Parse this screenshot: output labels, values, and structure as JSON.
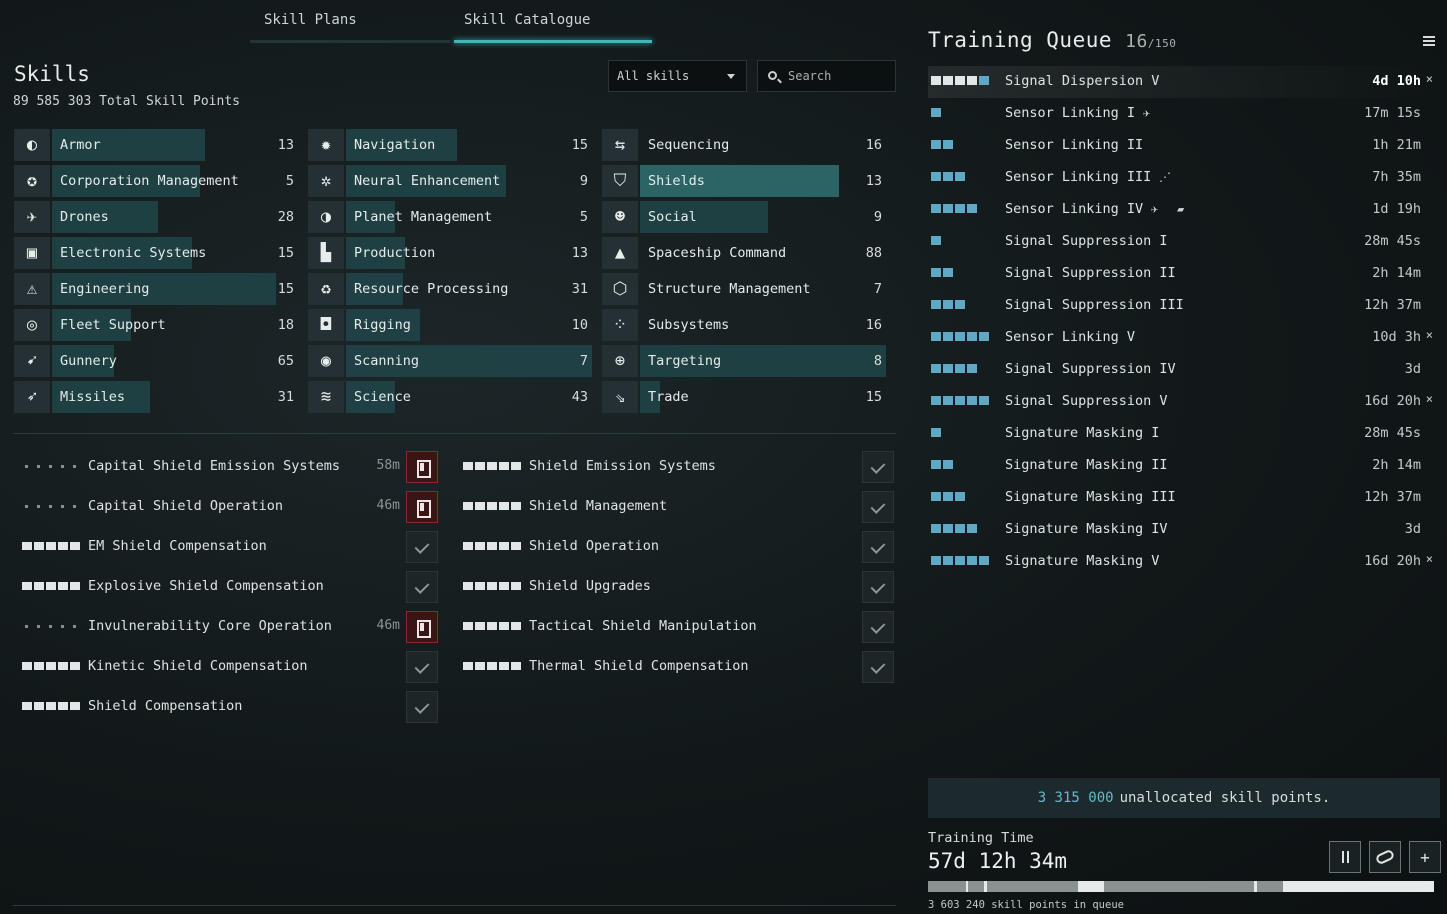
{
  "tabs": [
    {
      "label": "Skill Plans",
      "active": false
    },
    {
      "label": "Skill Catalogue",
      "active": true
    }
  ],
  "skills_header": {
    "title": "Skills",
    "total_sp": "89 585 303 Total Skill Points"
  },
  "filter": {
    "selected": "All skills"
  },
  "search": {
    "placeholder": "Search"
  },
  "categories": [
    {
      "label": "Armor",
      "count": "13",
      "fill": 0.62,
      "icon": "armor-icon"
    },
    {
      "label": "Corporation Management",
      "count": "5",
      "fill": 0.6,
      "icon": "corporation-icon"
    },
    {
      "label": "Drones",
      "count": "28",
      "fill": 0.43,
      "icon": "drone-icon"
    },
    {
      "label": "Electronic Systems",
      "count": "15",
      "fill": 0.57,
      "icon": "electronics-icon"
    },
    {
      "label": "Engineering",
      "count": "15",
      "fill": 0.91,
      "icon": "engineering-icon"
    },
    {
      "label": "Fleet Support",
      "count": "18",
      "fill": 0.32,
      "icon": "fleet-icon"
    },
    {
      "label": "Gunnery",
      "count": "65",
      "fill": 0.25,
      "icon": "gunnery-icon"
    },
    {
      "label": "Missiles",
      "count": "31",
      "fill": 0.4,
      "icon": "missile-icon"
    },
    {
      "label": "Navigation",
      "count": "15",
      "fill": 0.45,
      "icon": "navigation-icon"
    },
    {
      "label": "Neural Enhancement",
      "count": "9",
      "fill": 0.65,
      "icon": "neural-icon"
    },
    {
      "label": "Planet Management",
      "count": "5",
      "fill": 0.2,
      "icon": "planet-icon"
    },
    {
      "label": "Production",
      "count": "13",
      "fill": 0.24,
      "icon": "production-icon"
    },
    {
      "label": "Resource Processing",
      "count": "31",
      "fill": 0.23,
      "icon": "recycle-icon"
    },
    {
      "label": "Rigging",
      "count": "10",
      "fill": 0.3,
      "icon": "rigging-icon"
    },
    {
      "label": "Scanning",
      "count": "7",
      "fill": 1.0,
      "icon": "scanning-icon"
    },
    {
      "label": "Science",
      "count": "43",
      "fill": 0.2,
      "icon": "science-icon"
    },
    {
      "label": "Sequencing",
      "count": "16",
      "fill": 0.0,
      "icon": "sequencing-icon"
    },
    {
      "label": "Shields",
      "count": "13",
      "fill": 0.81,
      "icon": "shield-icon",
      "selected": true
    },
    {
      "label": "Social",
      "count": "9",
      "fill": 0.52,
      "icon": "social-icon"
    },
    {
      "label": "Spaceship Command",
      "count": "88",
      "fill": 0.0,
      "icon": "spaceship-icon"
    },
    {
      "label": "Structure Management",
      "count": "7",
      "fill": 0.0,
      "icon": "structure-icon"
    },
    {
      "label": "Subsystems",
      "count": "16",
      "fill": 0.0,
      "icon": "subsystems-icon"
    },
    {
      "label": "Targeting",
      "count": "8",
      "fill": 1.0,
      "icon": "targeting-icon"
    },
    {
      "label": "Trade",
      "count": "15",
      "fill": 0.08,
      "icon": "trade-icon"
    }
  ],
  "skill_list": [
    {
      "name": "Capital Shield Emission Systems",
      "level": 0,
      "time": "58m",
      "state": "inject"
    },
    {
      "name": "Capital Shield Operation",
      "level": 0,
      "time": "46m",
      "state": "inject"
    },
    {
      "name": "EM Shield Compensation",
      "level": 5,
      "time": "",
      "state": "trained"
    },
    {
      "name": "Explosive Shield Compensation",
      "level": 5,
      "time": "",
      "state": "trained"
    },
    {
      "name": "Invulnerability Core Operation",
      "level": 0,
      "time": "46m",
      "state": "inject"
    },
    {
      "name": "Kinetic Shield Compensation",
      "level": 5,
      "time": "",
      "state": "trained"
    },
    {
      "name": "Shield Compensation",
      "level": 5,
      "time": "",
      "state": "trained"
    },
    {
      "name": "Shield Emission Systems",
      "level": 5,
      "time": "",
      "state": "trained"
    },
    {
      "name": "Shield Management",
      "level": 5,
      "time": "",
      "state": "trained"
    },
    {
      "name": "Shield Operation",
      "level": 5,
      "time": "",
      "state": "trained"
    },
    {
      "name": "Shield Upgrades",
      "level": 5,
      "time": "",
      "state": "trained"
    },
    {
      "name": "Tactical Shield Manipulation",
      "level": 5,
      "time": "",
      "state": "trained"
    },
    {
      "name": "Thermal Shield Compensation",
      "level": 5,
      "time": "",
      "state": "trained"
    }
  ],
  "queue": {
    "title": "Training Queue",
    "count": "16",
    "max": "/150",
    "items": [
      {
        "name": "Signal Dispersion V",
        "done": 4,
        "level": 5,
        "time": "4d 10h",
        "removable": true,
        "badges": []
      },
      {
        "name": "Sensor Linking I",
        "done": 0,
        "level": 1,
        "time": "17m 15s",
        "removable": false,
        "badges": [
          "ship-icon"
        ]
      },
      {
        "name": "Sensor Linking II",
        "done": 0,
        "level": 2,
        "time": "1h 21m",
        "removable": false,
        "badges": []
      },
      {
        "name": "Sensor Linking III",
        "done": 0,
        "level": 3,
        "time": "7h 35m",
        "removable": false,
        "badges": [
          "ships-icon"
        ]
      },
      {
        "name": "Sensor Linking IV",
        "done": 0,
        "level": 4,
        "time": "1d 19h",
        "removable": false,
        "badges": [
          "ship-icon",
          "module-icon"
        ]
      },
      {
        "name": "Signal Suppression I",
        "done": 0,
        "level": 1,
        "time": "28m 45s",
        "removable": false,
        "badges": []
      },
      {
        "name": "Signal Suppression II",
        "done": 0,
        "level": 2,
        "time": "2h 14m",
        "removable": false,
        "badges": []
      },
      {
        "name": "Signal Suppression III",
        "done": 0,
        "level": 3,
        "time": "12h 37m",
        "removable": false,
        "badges": []
      },
      {
        "name": "Sensor Linking V",
        "done": 0,
        "level": 5,
        "time": "10d 3h",
        "removable": true,
        "badges": []
      },
      {
        "name": "Signal Suppression IV",
        "done": 0,
        "level": 4,
        "time": "3d",
        "removable": false,
        "badges": []
      },
      {
        "name": "Signal Suppression V",
        "done": 0,
        "level": 5,
        "time": "16d 20h",
        "removable": true,
        "badges": []
      },
      {
        "name": "Signature Masking I",
        "done": 0,
        "level": 1,
        "time": "28m 45s",
        "removable": false,
        "badges": []
      },
      {
        "name": "Signature Masking II",
        "done": 0,
        "level": 2,
        "time": "2h 14m",
        "removable": false,
        "badges": []
      },
      {
        "name": "Signature Masking III",
        "done": 0,
        "level": 3,
        "time": "12h 37m",
        "removable": false,
        "badges": []
      },
      {
        "name": "Signature Masking IV",
        "done": 0,
        "level": 4,
        "time": "3d",
        "removable": false,
        "badges": []
      },
      {
        "name": "Signature Masking V",
        "done": 0,
        "level": 5,
        "time": "16d 20h",
        "removable": true,
        "badges": []
      }
    ],
    "remove_glyph": "×",
    "unallocated_value": "3 315 000",
    "unallocated_text": "unallocated skill points.",
    "training_time_label": "Training Time",
    "training_time_value": "57d 12h 34m",
    "sp_in_queue": "3 603 240 skill points in queue",
    "controls": {
      "pause": "⏸",
      "link": "🔗",
      "add": "+"
    }
  },
  "colors": {
    "accent": "#3fb6b8",
    "queue_pip": "#5fa9c6",
    "category_bar": "#1f4346",
    "inject_red": "#8a2a2a"
  }
}
